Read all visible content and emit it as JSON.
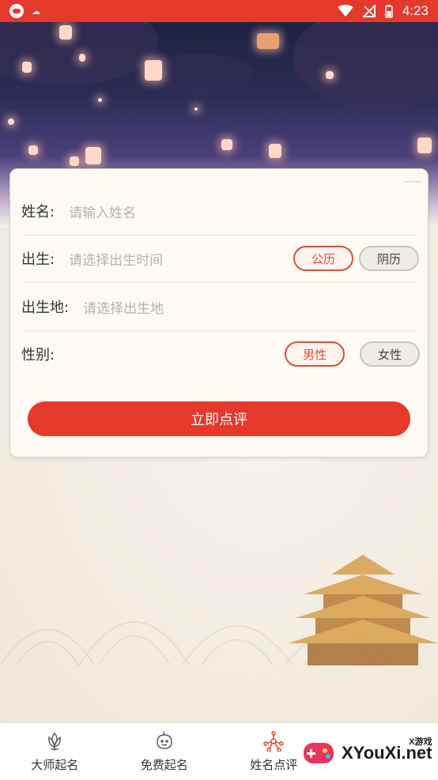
{
  "status_bar": {
    "time": "4:23"
  },
  "form": {
    "name": {
      "label": "姓名:",
      "placeholder": "请输入姓名"
    },
    "birth": {
      "label": "出生:",
      "placeholder": "请选择出生时间",
      "calendar_options": [
        "公历",
        "阴历"
      ],
      "selected_calendar": "公历"
    },
    "birthplace": {
      "label": "出生地:",
      "placeholder": "请选择出生地"
    },
    "gender": {
      "label": "性别:",
      "options": [
        "男性",
        "女性"
      ],
      "selected": "男性"
    },
    "submit_label": "立即点评"
  },
  "tabs": [
    {
      "label": "大师起名",
      "icon": "lotus-icon"
    },
    {
      "label": "免费起名",
      "icon": "baby-icon"
    },
    {
      "label": "姓名点评",
      "icon": "network-icon",
      "active": true
    },
    {
      "label": "",
      "icon": "profile-icon"
    }
  ],
  "watermark": {
    "brand": "XYouXi.net",
    "small": "X游戏"
  },
  "colors": {
    "accent": "#e4392b",
    "active_outline": "#d9503d"
  }
}
